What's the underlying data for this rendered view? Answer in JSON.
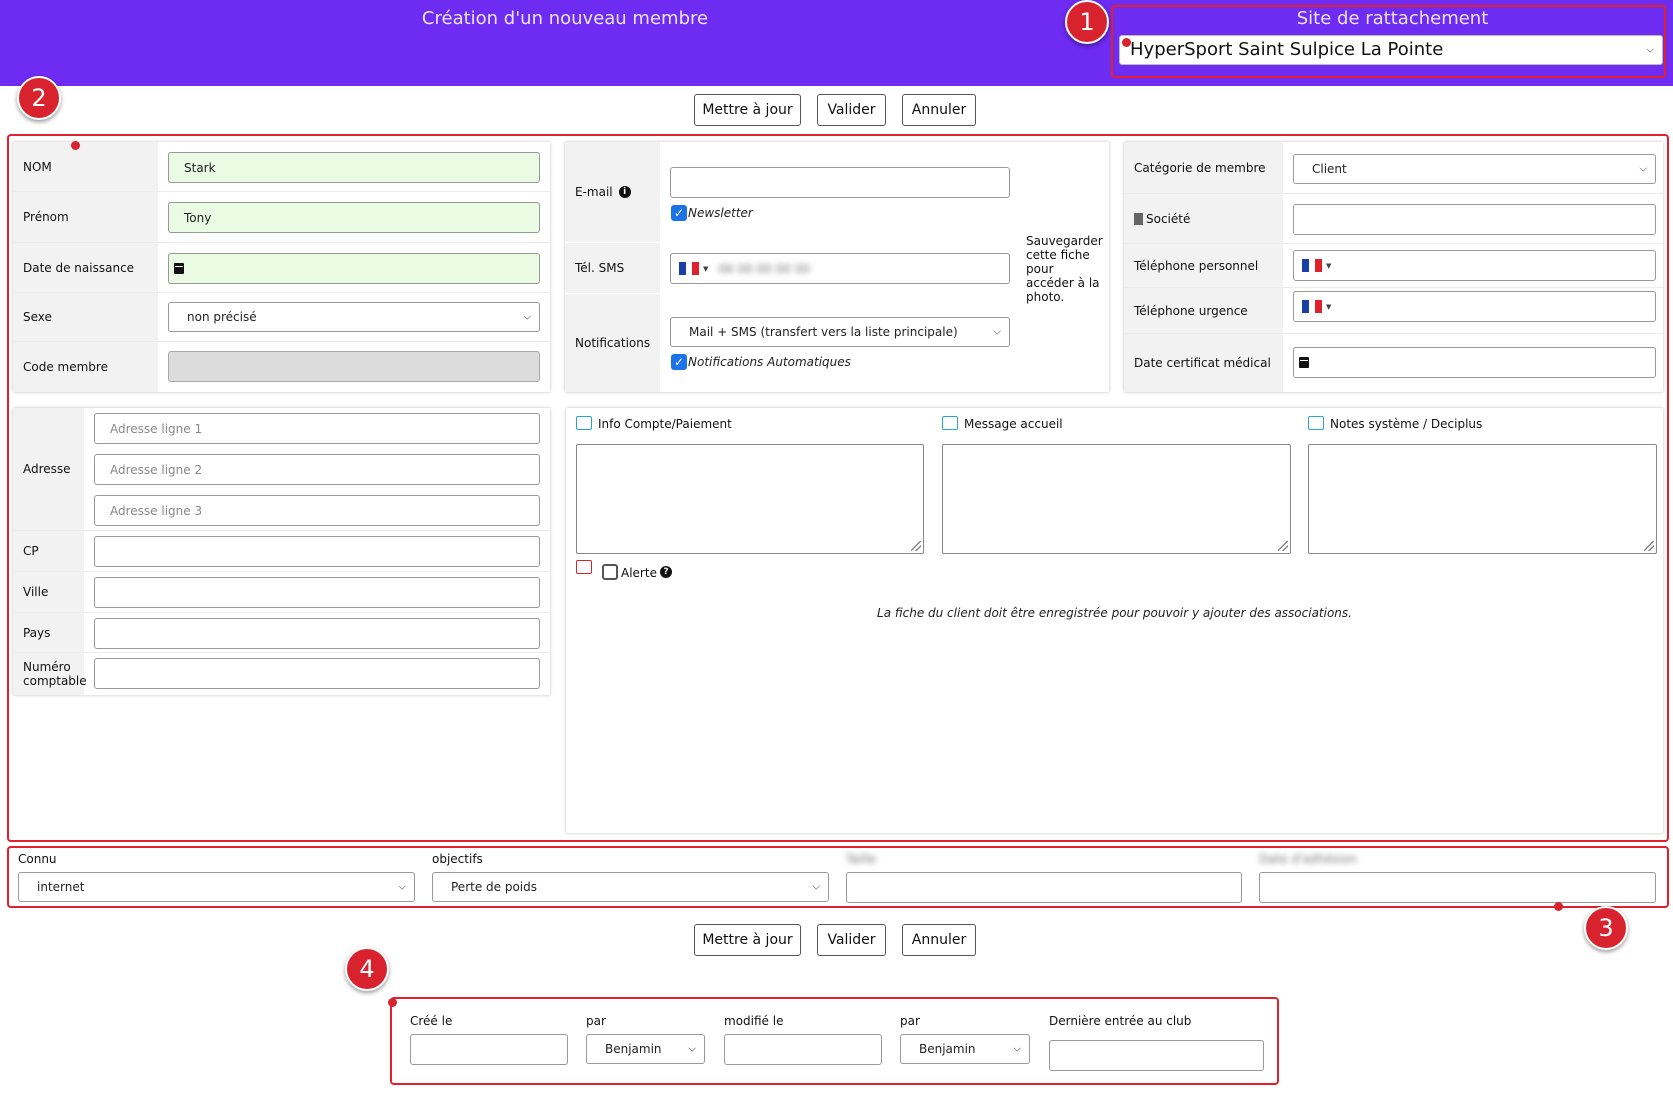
{
  "header": {
    "title": "Création d'un nouveau membre",
    "site_label": "Site de rattachement",
    "site_value": "HyperSport Saint Sulpice La Pointe"
  },
  "actions": {
    "update": "Mettre à jour",
    "validate": "Valider",
    "cancel": "Annuler"
  },
  "identity": {
    "nom_label": "NOM",
    "nom_value": "Stark",
    "prenom_label": "Prénom",
    "prenom_value": "Tony",
    "dob_label": "Date de naissance",
    "sexe_label": "Sexe",
    "sexe_value": "non précisé",
    "code_label": "Code membre"
  },
  "contact": {
    "email_label": "E-mail",
    "newsletter": "Newsletter",
    "sms_label": "Tél. SMS",
    "sms_value": "06 00 00 00 00",
    "notif_label": "Notifications",
    "notif_value": "Mail + SMS (transfert vers la liste principale)",
    "auto_notif": "Notifications Automatiques",
    "photo_note": "Sauvegarder cette fiche pour accéder à la photo."
  },
  "category": {
    "cat_label": "Catégorie de membre",
    "cat_value": "Client",
    "societe_label": "Société",
    "tel_perso_label": "Téléphone personnel",
    "tel_urg_label": "Téléphone urgence",
    "certif_label": "Date certificat médical"
  },
  "address": {
    "adresse_label": "Adresse",
    "line1_ph": "Adresse ligne 1",
    "line2_ph": "Adresse ligne 2",
    "line3_ph": "Adresse ligne 3",
    "cp_label": "CP",
    "ville_label": "Ville",
    "pays_label": "Pays",
    "num_label": "Numéro comptable"
  },
  "notes": {
    "info_label": "Info Compte/Paiement",
    "message_label": "Message accueil",
    "system_label": "Notes système / Deciplus",
    "alerte_label": "Alerte",
    "association_note": "La fiche du client doit être enregistrée pour pouvoir y ajouter des associations."
  },
  "extra": {
    "connu_label": "Connu",
    "connu_value": "internet",
    "objectifs_label": "objectifs",
    "objectifs_value": "Perte de poids",
    "field3_label": "Taille",
    "field4_label": "Date d'adhésion"
  },
  "audit": {
    "created_label": "Créé le",
    "by1_label": "par",
    "by1_value": "Benjamin",
    "modified_label": "modifié le",
    "by2_label": "par",
    "by2_value": "Benjamin",
    "last_entry_label": "Dernière entrée au club"
  },
  "markers": [
    "1",
    "2",
    "3",
    "4"
  ],
  "colors": {
    "header": "#6e2bf2",
    "highlight": "#e0202a",
    "required_bg": "#e9fbe3",
    "checkbox": "#1a73e8"
  }
}
